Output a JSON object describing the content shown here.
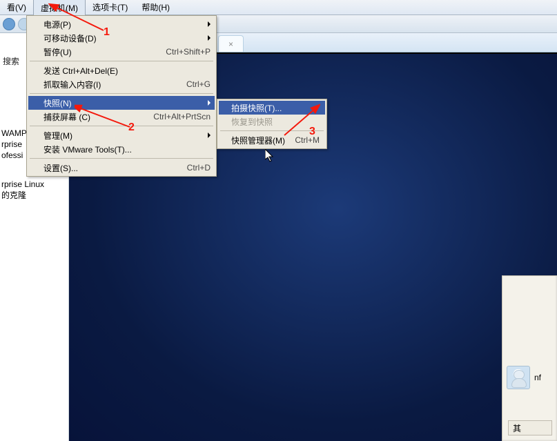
{
  "menubar": {
    "items": [
      {
        "label": "看(V)"
      },
      {
        "label": "虚拟机(M)"
      },
      {
        "label": "选项卡(T)"
      },
      {
        "label": "帮助(H)"
      }
    ]
  },
  "sidebar": {
    "search_label": "搜索",
    "items": [
      "WAMP",
      "rprise",
      "ofessi",
      "rprise Linux",
      "的克隆"
    ]
  },
  "tabs": {
    "items": [
      {
        "close_marker": "×"
      }
    ]
  },
  "menu_level1": {
    "rows": [
      {
        "label": "电源(P)",
        "has_submenu": true,
        "accel": ""
      },
      {
        "label": "可移动设备(D)",
        "has_submenu": true,
        "accel": ""
      },
      {
        "label": "暂停(U)",
        "accel": "Ctrl+Shift+P"
      },
      {
        "sep": true
      },
      {
        "label": "发送 Ctrl+Alt+Del(E)",
        "accel": ""
      },
      {
        "label": "抓取输入内容(I)",
        "accel": "Ctrl+G"
      },
      {
        "sep": true
      },
      {
        "label": "快照(N)",
        "has_submenu": true,
        "highlight": true
      },
      {
        "label": "捕获屏幕 (C)",
        "accel": "Ctrl+Alt+PrtScn"
      },
      {
        "sep": true
      },
      {
        "label": "管理(M)",
        "has_submenu": true
      },
      {
        "label": "安装 VMware Tools(T)...",
        "accel": ""
      },
      {
        "sep": true
      },
      {
        "label": "设置(S)...",
        "accel": "Ctrl+D"
      }
    ]
  },
  "submenu_snapshot": {
    "rows": [
      {
        "label": "拍摄快照(T)...",
        "highlight": true
      },
      {
        "label": "恢复到快照",
        "disabled": true
      },
      {
        "sep": true
      },
      {
        "label": "快照管理器(M)",
        "accel": "Ctrl+M"
      }
    ]
  },
  "annotations": {
    "labels": [
      "1",
      "2",
      "3"
    ]
  },
  "login": {
    "username": "nf",
    "other_label": "其"
  }
}
